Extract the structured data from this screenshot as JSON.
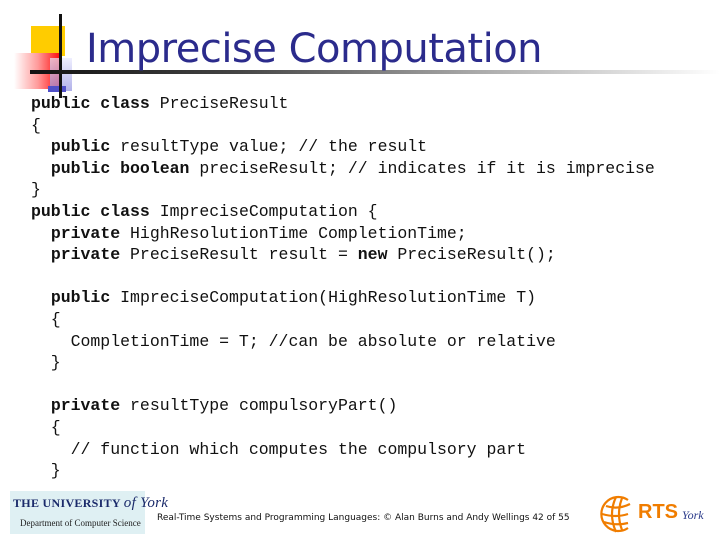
{
  "slide": {
    "title": "Imprecise Computation",
    "code_lines": [
      [
        {
          "t": "public class",
          "k": true
        },
        {
          "t": " PreciseResult",
          "k": false
        }
      ],
      [
        {
          "t": "{",
          "k": false
        }
      ],
      [
        {
          "t": "  ",
          "k": false
        },
        {
          "t": "public",
          "k": true
        },
        {
          "t": " resultType value; // the result",
          "k": false
        }
      ],
      [
        {
          "t": "  ",
          "k": false
        },
        {
          "t": "public boolean",
          "k": true
        },
        {
          "t": " preciseResult; // indicates if it is imprecise",
          "k": false
        }
      ],
      [
        {
          "t": "}",
          "k": false
        }
      ],
      [
        {
          "t": "public class",
          "k": true
        },
        {
          "t": " ImpreciseComputation {",
          "k": false
        }
      ],
      [
        {
          "t": "  ",
          "k": false
        },
        {
          "t": "private",
          "k": true
        },
        {
          "t": " HighResolutionTime CompletionTime;",
          "k": false
        }
      ],
      [
        {
          "t": "  ",
          "k": false
        },
        {
          "t": "private",
          "k": true
        },
        {
          "t": " PreciseResult result = ",
          "k": false
        },
        {
          "t": "new",
          "k": true
        },
        {
          "t": " PreciseResult();",
          "k": false
        }
      ],
      [
        {
          "t": "",
          "k": false
        }
      ],
      [
        {
          "t": "  ",
          "k": false
        },
        {
          "t": "public",
          "k": true
        },
        {
          "t": " ImpreciseComputation(HighResolutionTime T)",
          "k": false
        }
      ],
      [
        {
          "t": "  {",
          "k": false
        }
      ],
      [
        {
          "t": "    CompletionTime = T; //can be absolute or relative",
          "k": false
        }
      ],
      [
        {
          "t": "  }",
          "k": false
        }
      ],
      [
        {
          "t": "",
          "k": false
        }
      ],
      [
        {
          "t": "  ",
          "k": false
        },
        {
          "t": "private",
          "k": true
        },
        {
          "t": " resultType compulsoryPart()",
          "k": false
        }
      ],
      [
        {
          "t": "  {",
          "k": false
        }
      ],
      [
        {
          "t": "    // function which computes the compulsory part",
          "k": false
        }
      ],
      [
        {
          "t": "  }",
          "k": false
        }
      ]
    ],
    "footer": "Real-Time Systems and Programming Languages: © Alan Burns and Andy Wellings 42 of 55"
  },
  "logos": {
    "york_top": "THE UNIVERSITY",
    "york_of": "of York",
    "york_dept": "Department of Computer Science",
    "rts": "RTS",
    "rts_york": "York"
  },
  "colors": {
    "title": "#2b2b8c",
    "accent_yellow": "#ffcc00",
    "accent_red": "#ff0000",
    "rts_orange": "#f07d00"
  }
}
